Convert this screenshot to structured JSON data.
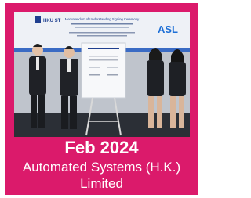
{
  "card": {
    "date": "Feb 2024",
    "company_line1": "Automated Systems (H.K.)",
    "company_line2": "Limited",
    "accent_color": "#db1a6b"
  },
  "photo": {
    "banner_title": "Memorandum of Understanding Signing Ceremony",
    "logo_left": "HKU ST",
    "logo_right": "ASL"
  }
}
